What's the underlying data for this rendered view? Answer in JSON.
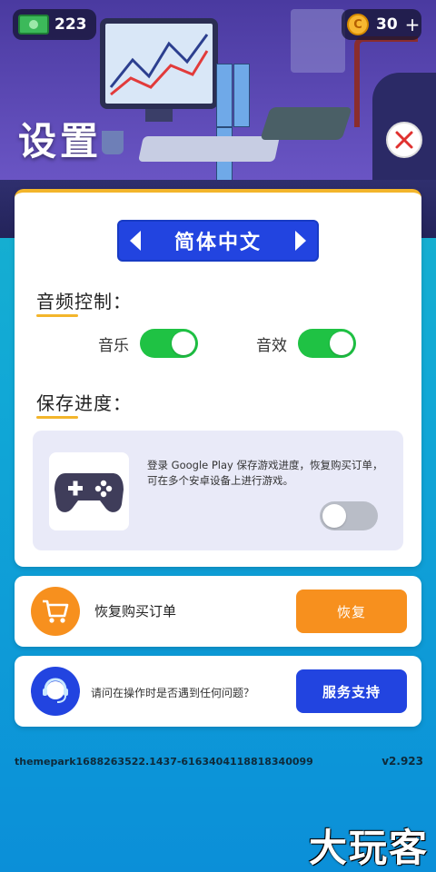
{
  "hud": {
    "cash": "223",
    "coins": "30",
    "coin_plus": "+",
    "coin_symbol": "C"
  },
  "page": {
    "title": "设置"
  },
  "language": {
    "selected": "简体中文"
  },
  "audio": {
    "title": "音频控制：",
    "music_label": "音乐",
    "music_on": true,
    "sfx_label": "音效",
    "sfx_on": true
  },
  "save": {
    "title": "保存进度：",
    "description": "登录 Google Play 保存游戏进度，恢复购买订单，可在多个安卓设备上进行游戏。",
    "google_play_on": false
  },
  "restore": {
    "label": "恢复购买订单",
    "button": "恢复"
  },
  "support": {
    "question": "请问在操作时是否遇到任何问题？",
    "button": "服务支持"
  },
  "footer": {
    "id": "themepark1688263522.1437-6163404118818340099",
    "version": "v2.923"
  },
  "watermark": "大玩客",
  "colors": {
    "accent_blue": "#2244e0",
    "accent_orange": "#f7901e",
    "toggle_on": "#1fc244",
    "underline_yellow": "#f3b52b"
  }
}
